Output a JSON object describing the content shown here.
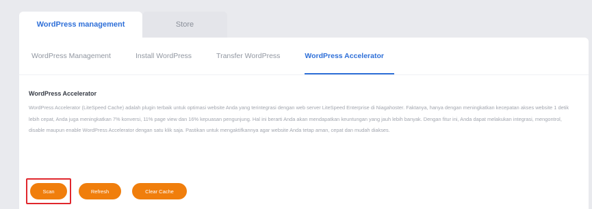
{
  "top_tabs": [
    {
      "label": "WordPress management",
      "active": true
    },
    {
      "label": "Store",
      "active": false
    }
  ],
  "sub_tabs": [
    {
      "label": "WordPress Management",
      "active": false
    },
    {
      "label": "Install WordPress",
      "active": false
    },
    {
      "label": "Transfer WordPress",
      "active": false
    },
    {
      "label": "WordPress Accelerator",
      "active": true
    }
  ],
  "section": {
    "title": "WordPress Accelerator",
    "description": "WordPress Accelerator (LiteSpeed Cache) adalah plugin terbaik untuk optimasi website Anda yang terintegrasi dengan web server LiteSpeed Enterprise di Niagahoster. Faktanya, hanya dengan meningkatkan kecepatan akses website 1 detik lebih cepat, Anda juga meningkatkan 7% konversi, 11% page view dan 16% kepuasan pengunjung. Hal ini berarti Anda akan mendapatkan keuntungan yang jauh lebih banyak. Dengan fitur ini, Anda dapat melakukan integrasi, mengontrol, disable maupun enable WordPress Accelerator dengan satu klik saja. Pastikan untuk mengaktifkannya agar website Anda tetap aman, cepat dan mudah diakses."
  },
  "buttons": {
    "scan": "Scan",
    "refresh": "Refresh",
    "clear_cache": "Clear Cache"
  },
  "colors": {
    "accent_blue": "#2e6fd8",
    "button_orange": "#f07e0c",
    "highlight_red": "#e0262c"
  }
}
